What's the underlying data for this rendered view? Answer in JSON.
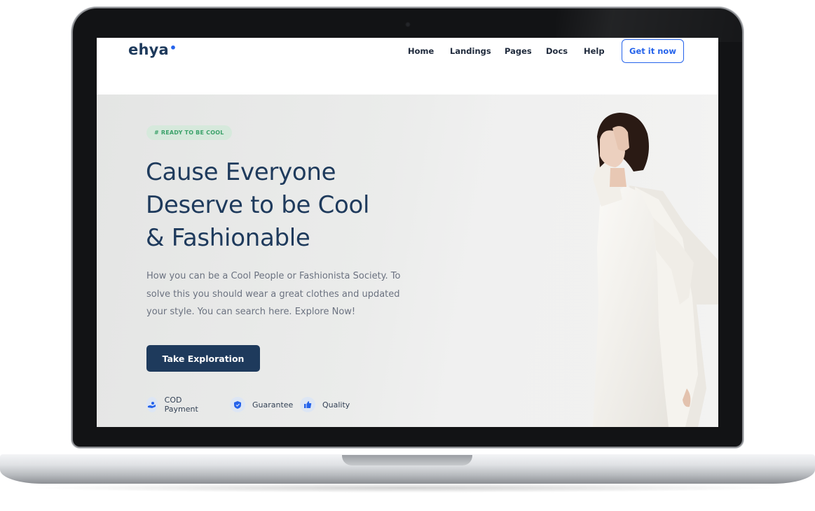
{
  "nav": {
    "logo": "ehya",
    "links": [
      "Home",
      "Landings",
      "Pages",
      "Docs",
      "Help"
    ],
    "cta_label": "Get it now"
  },
  "hero": {
    "badge": "# READY TO BE COOL",
    "headline_lines": [
      "Cause Everyone",
      "Deserve to be Cool",
      "& Fashionable"
    ],
    "description_lines": [
      "How you can be a Cool People or Fashionista Society. To",
      "solve this you should wear a great clothes and updated",
      "your style. You can search here. Explore Now!"
    ],
    "button_label": "Take Exploration",
    "features": [
      {
        "label": "COD Payment",
        "icon": "hand-coin-icon"
      },
      {
        "label": "Guarantee",
        "icon": "shield-icon"
      },
      {
        "label": "Quality",
        "icon": "thumbs-up-icon"
      }
    ]
  },
  "colors": {
    "primary": "#1e3a5c",
    "accent": "#2563eb",
    "badge_bg": "#d6e9dc",
    "badge_text": "#3ba26a",
    "text_muted": "#6b7280"
  }
}
